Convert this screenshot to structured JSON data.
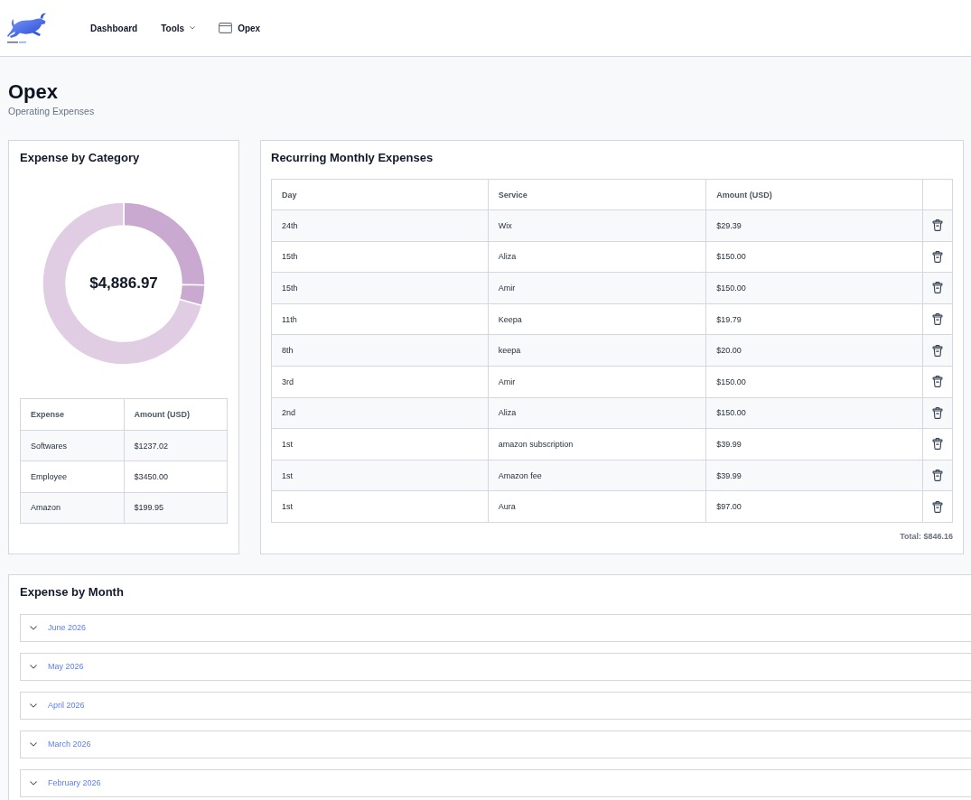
{
  "header": {
    "nav": [
      {
        "label": "Dashboard",
        "kind": "link"
      },
      {
        "label": "Tools",
        "kind": "dropdown"
      },
      {
        "label": "Opex",
        "kind": "page"
      }
    ]
  },
  "page": {
    "title": "Opex",
    "subtitle": "Operating Expenses"
  },
  "category_card": {
    "title": "Expense by Category",
    "total": "$4,886.97",
    "chart_data": {
      "type": "donut",
      "values": [
        25.31,
        4.09,
        70.6
      ],
      "colors": [
        "#c9a9cf",
        "#c9a9cf",
        "#e0cde4"
      ]
    },
    "table": {
      "columns": [
        "Expense",
        "Amount (USD)"
      ],
      "rows": [
        [
          "Softwares",
          "$1237.02"
        ],
        [
          "Employee",
          "$3450.00"
        ],
        [
          "Amazon",
          "$199.95"
        ]
      ]
    }
  },
  "recurring_card": {
    "title": "Recurring Monthly Expenses",
    "table": {
      "columns": [
        "Day",
        "Service",
        "Amount (USD)"
      ],
      "rows": [
        {
          "day": "24th",
          "service": "Wix",
          "amount": "$29.39"
        },
        {
          "day": "15th",
          "service": "Aliza",
          "amount": "$150.00"
        },
        {
          "day": "15th",
          "service": "Amir",
          "amount": "$150.00"
        },
        {
          "day": "11th",
          "service": "Keepa",
          "amount": "$19.79"
        },
        {
          "day": "8th",
          "service": "keepa",
          "amount": "$20.00"
        },
        {
          "day": "3rd",
          "service": "Amir",
          "amount": "$150.00"
        },
        {
          "day": "2nd",
          "service": "Aliza",
          "amount": "$150.00"
        },
        {
          "day": "1st",
          "service": "amazon subscription",
          "amount": "$39.99"
        },
        {
          "day": "1st",
          "service": "Amazon fee",
          "amount": "$39.99"
        },
        {
          "day": "1st",
          "service": "Aura",
          "amount": "$97.00"
        }
      ]
    },
    "total": "Total: $846.16"
  },
  "month_card": {
    "title": "Expense by Month",
    "months": [
      {
        "label": "June 2026",
        "expanded": false
      },
      {
        "label": "May 2026",
        "expanded": false
      },
      {
        "label": "April 2026",
        "expanded": false
      },
      {
        "label": "March 2026",
        "expanded": false
      },
      {
        "label": "February 2026",
        "expanded": false
      }
    ]
  }
}
